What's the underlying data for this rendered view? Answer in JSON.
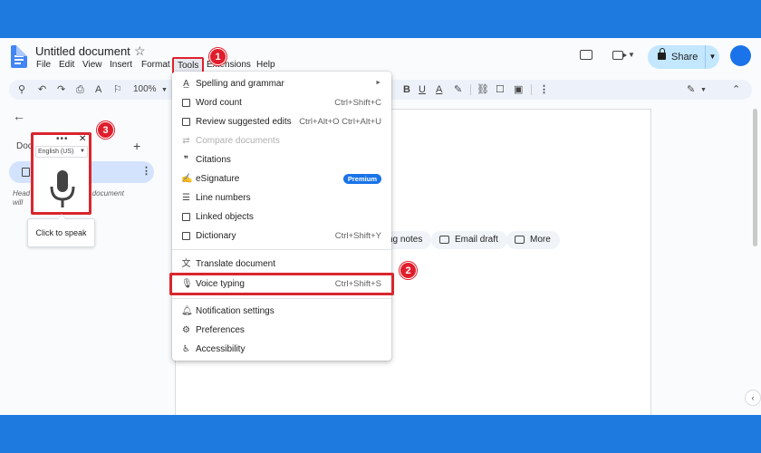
{
  "document": {
    "title": "Untitled document"
  },
  "menubar": [
    "File",
    "Edit",
    "View",
    "Insert",
    "Format",
    "Tools",
    "Extensions",
    "Help"
  ],
  "header": {
    "share_label": "Share"
  },
  "toolbar": {
    "zoom": "100%"
  },
  "left_panel": {
    "outline_label": "Doc",
    "hint_line1": "Head",
    "hint_line1_tail": "e document",
    "hint_line2": "will"
  },
  "voice_widget": {
    "language": "English (US)",
    "tooltip": "Click to speak"
  },
  "chips": [
    {
      "label": "ng notes"
    },
    {
      "label": "Email draft"
    },
    {
      "label": "More"
    }
  ],
  "tools_menu": {
    "items": [
      {
        "label": "Spelling and grammar",
        "shortcut": "",
        "submenu": true,
        "icon": "spellcheck-icon"
      },
      {
        "label": "Word count",
        "shortcut": "Ctrl+Shift+C",
        "icon": "word-count-icon"
      },
      {
        "label": "Review suggested edits",
        "shortcut": "Ctrl+Alt+O Ctrl+Alt+U",
        "icon": "review-edits-icon"
      },
      {
        "label": "Compare documents",
        "shortcut": "",
        "disabled": true,
        "icon": "compare-icon"
      },
      {
        "label": "Citations",
        "shortcut": "",
        "icon": "citations-icon"
      },
      {
        "label": "eSignature",
        "badge": "Premium",
        "icon": "esignature-icon"
      },
      {
        "label": "Line numbers",
        "shortcut": "",
        "icon": "line-numbers-icon"
      },
      {
        "label": "Linked objects",
        "shortcut": "",
        "icon": "linked-objects-icon"
      },
      {
        "label": "Dictionary",
        "shortcut": "Ctrl+Shift+Y",
        "icon": "dictionary-icon"
      },
      {
        "label": "Translate document",
        "shortcut": "",
        "icon": "translate-icon"
      },
      {
        "label": "Voice typing",
        "shortcut": "Ctrl+Shift+S",
        "icon": "microphone-icon"
      },
      {
        "label": "Notification settings",
        "shortcut": "",
        "icon": "bell-icon"
      },
      {
        "label": "Preferences",
        "shortcut": "",
        "icon": "preferences-icon"
      },
      {
        "label": "Accessibility",
        "shortcut": "",
        "icon": "accessibility-icon"
      }
    ]
  },
  "annotations": [
    "1",
    "2",
    "3"
  ],
  "colors": {
    "frame": "#1f7ae0",
    "highlight": "#d9262e",
    "badge": "#e01e2b"
  }
}
